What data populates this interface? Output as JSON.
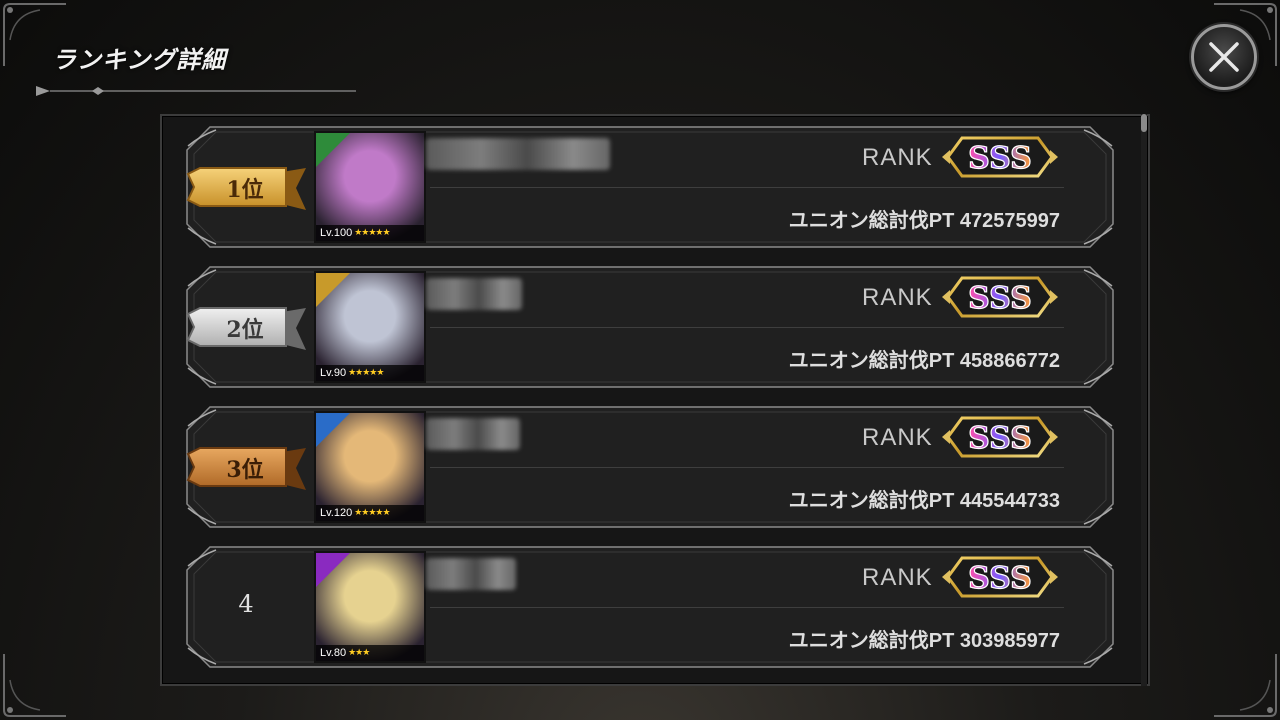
{
  "header": {
    "title": "ランキング詳細"
  },
  "close_button": {
    "icon": "close-icon"
  },
  "rows": [
    {
      "rank_label": "1位",
      "badge": "gold",
      "level": "Lv.100",
      "stars": "★★★★★",
      "rank_text": "RANK",
      "rank_grade": "SSS",
      "points_text": "ユニオン総討伐PT 472575997",
      "frame_color": "#2e8b3a",
      "art_color": "#c07ac8"
    },
    {
      "rank_label": "2位",
      "badge": "silver",
      "level": "Lv.90",
      "stars": "★★★★★",
      "rank_text": "RANK",
      "rank_grade": "SSS",
      "points_text": "ユニオン総討伐PT 458866772",
      "frame_color": "#c89a2a",
      "art_color": "#bfc4d4"
    },
    {
      "rank_label": "3位",
      "badge": "bronze",
      "level": "Lv.120",
      "stars": "★★★★★",
      "rank_text": "RANK",
      "rank_grade": "SSS",
      "points_text": "ユニオン総討伐PT 445544733",
      "frame_color": "#2a6cc8",
      "art_color": "#e4b878"
    },
    {
      "rank_label": "4",
      "badge": "none",
      "level": "Lv.80",
      "stars": "★★★",
      "rank_text": "RANK",
      "rank_grade": "SSS",
      "points_text": "ユニオン総討伐PT 303985977",
      "frame_color": "#8a2ac0",
      "art_color": "#e6d290"
    }
  ]
}
